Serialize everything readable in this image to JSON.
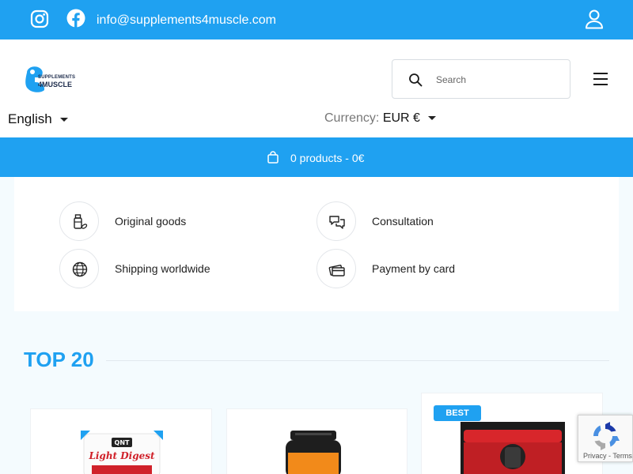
{
  "topbar": {
    "email": "info@supplements4muscle.com",
    "icons": [
      "instagram-icon",
      "facebook-icon",
      "user-icon"
    ]
  },
  "header": {
    "logo_line1": "SUPPLEMENTS",
    "logo_line2": "4MUSCLE",
    "search_placeholder": "Search",
    "language": "English",
    "currency_label": "Currency:",
    "currency_value": "EUR €"
  },
  "cart": {
    "summary": "0 products - 0€"
  },
  "features": [
    {
      "label": "Original goods",
      "icon": "supplement-bottle-icon"
    },
    {
      "label": "Consultation",
      "icon": "chat-bubbles-icon"
    },
    {
      "label": "Shipping worldwide",
      "icon": "globe-icon"
    },
    {
      "label": "Payment by card",
      "icon": "credit-card-icon"
    }
  ],
  "top_section": {
    "title": "TOP 20",
    "badge": "BEST",
    "products": [
      {
        "image": "qnt-light-digest-product-image",
        "brand": "QNT",
        "name": "Light Digest"
      },
      {
        "image": "protein-tub-product-image"
      },
      {
        "image": "preworkout-tub-product-image"
      }
    ]
  },
  "recaptcha": {
    "links": "Privacy - Terms"
  },
  "colors": {
    "primary": "#1fa1f1",
    "text": "#1a1a1a",
    "background": "#f4fbfe"
  }
}
